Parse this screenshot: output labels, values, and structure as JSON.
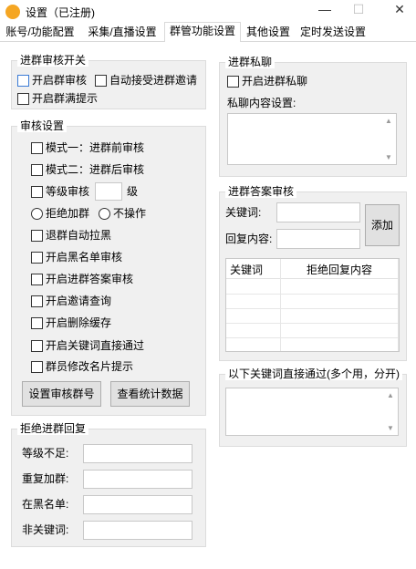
{
  "window": {
    "title": "设置（已注册)",
    "minimize": "—",
    "maximize": "☐",
    "close": "✕"
  },
  "tabs": [
    "账号/功能配置",
    "采集/直播设置",
    "群管功能设置",
    "其他设置",
    "定时发送设置"
  ],
  "left": {
    "join_switch": {
      "title": "进群审核开关",
      "open_review": "开启群审核",
      "auto_accept": "自动接受进群邀请",
      "full_tip": "开启群满提示"
    },
    "review": {
      "title": "审核设置",
      "mode1": "模式一：进群前审核",
      "mode2": "模式二：进群后审核",
      "level": "等级审核",
      "level_unit": "级",
      "level_value": "",
      "reject": "拒绝加群",
      "no_op": "不操作",
      "auto_kick": "退群自动拉黑",
      "blacklist": "开启黑名单审核",
      "answer_review": "开启进群答案审核",
      "invite_query": "开启邀请查询",
      "delete_cache": "开启删除缓存",
      "keyword_pass": "开启关键词直接通过",
      "card_tip": "群员修改名片提示",
      "btn_set_group": "设置审核群号",
      "btn_stats": "查看统计数据"
    },
    "reject_reply": {
      "title": "拒绝进群回复",
      "level_low": "等级不足:",
      "dup_join": "重复加群:",
      "in_blacklist": "在黑名单:",
      "not_keyword": "非关键词:",
      "level_low_value": "",
      "dup_join_value": "",
      "in_blacklist_value": "",
      "not_keyword_value": ""
    }
  },
  "right": {
    "private": {
      "title": "进群私聊",
      "enable": "开启进群私聊",
      "content_label": "私聊内容设置:",
      "content_value": ""
    },
    "answer": {
      "title": "进群答案审核",
      "keyword_label": "关键词:",
      "reply_label": "回复内容:",
      "keyword_value": "",
      "reply_value": "",
      "add_button": "添加",
      "columns": [
        "关键词",
        "拒绝回复内容"
      ]
    },
    "pass_keywords": {
      "title": "以下关键词直接通过(多个用，分开)",
      "value": ""
    }
  }
}
